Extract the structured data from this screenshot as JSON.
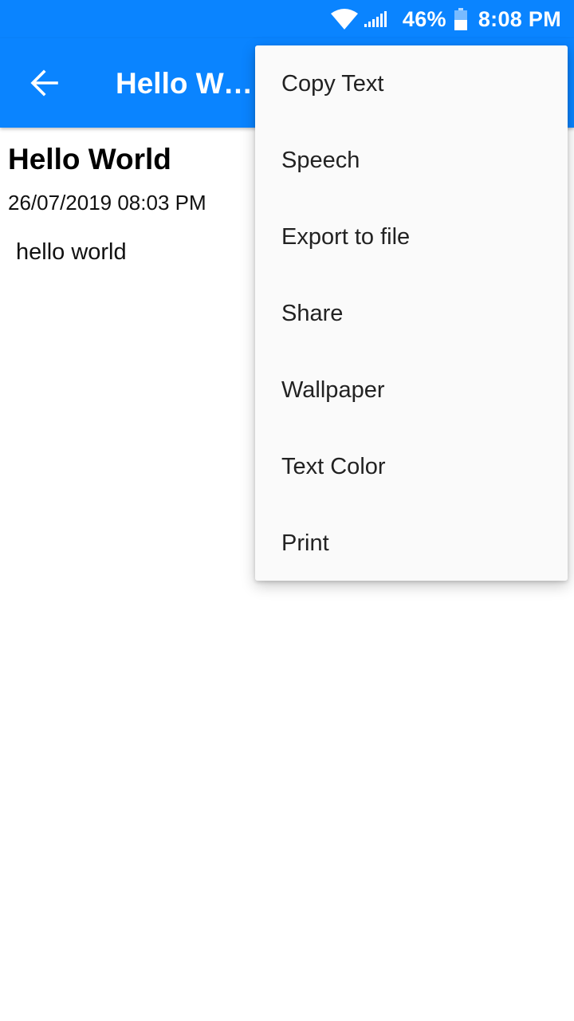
{
  "status_bar": {
    "battery_percent": "46%",
    "time": "8:08 PM",
    "icons": [
      "wifi-icon",
      "cell-signal-icon",
      "battery-icon"
    ]
  },
  "app_bar": {
    "title": "Hello World",
    "back_icon": "arrow-left-icon"
  },
  "note": {
    "title": "Hello World",
    "date": "26/07/2019 08:03 PM",
    "body": "hello world"
  },
  "menu": {
    "items": [
      {
        "label": "Copy Text"
      },
      {
        "label": "Speech"
      },
      {
        "label": "Export to file"
      },
      {
        "label": "Share"
      },
      {
        "label": "Wallpaper"
      },
      {
        "label": "Text Color"
      },
      {
        "label": "Print"
      }
    ]
  },
  "colors": {
    "primary": "#0a84ff",
    "menu_background": "#fafafa",
    "menu_text": "#222222"
  }
}
